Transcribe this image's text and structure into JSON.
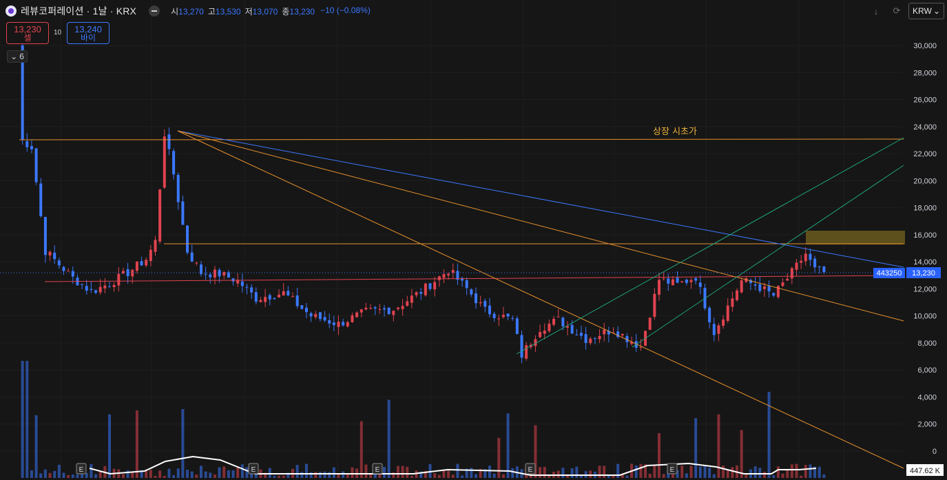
{
  "header": {
    "title": "레뷰코퍼레이션 · 1날 · KRX",
    "ohlc": [
      {
        "key": "시",
        "value": "13,270"
      },
      {
        "key": "고",
        "value": "13,530"
      },
      {
        "key": "저",
        "value": "13,070"
      },
      {
        "key": "종",
        "value": "13,230"
      }
    ],
    "change": "−10 (−0.08%)",
    "icons": {
      "logo": "symbol-logo-icon",
      "visibility": "eye-icon",
      "download": "download-icon",
      "refresh": "refresh-icon"
    }
  },
  "trade": {
    "sell_price": "13,230",
    "sell_label": "셀",
    "spread": "10",
    "buy_price": "13,240",
    "buy_label": "바이"
  },
  "indicators_toggle": {
    "count": "6"
  },
  "currency": "KRW",
  "colors": {
    "up": "#e0434f",
    "down": "#3b78ff",
    "background": "#161616",
    "accent": "#f0b33a"
  },
  "chart_data": {
    "type": "candlestick",
    "title": "",
    "y_ticks": [
      "30,000",
      "28,000",
      "26,000",
      "24,000",
      "22,000",
      "20,000",
      "18,000",
      "16,000",
      "14,000",
      "12,000",
      "10,000",
      "8,000",
      "6,000",
      "4,000",
      "2,000",
      "0"
    ],
    "ylim": [
      0,
      31000
    ],
    "bars_count": 165,
    "price_path_nodes": [
      [
        0,
        30000
      ],
      [
        1,
        23000
      ],
      [
        3,
        22500
      ],
      [
        6,
        14800
      ],
      [
        9,
        13800
      ],
      [
        12,
        12800
      ],
      [
        16,
        11800
      ],
      [
        20,
        12400
      ],
      [
        24,
        13200
      ],
      [
        28,
        14200
      ],
      [
        30,
        15500
      ],
      [
        32,
        23500
      ],
      [
        34,
        20500
      ],
      [
        37,
        14800
      ],
      [
        40,
        13200
      ],
      [
        44,
        13100
      ],
      [
        48,
        12600
      ],
      [
        52,
        11300
      ],
      [
        58,
        11700
      ],
      [
        64,
        10000
      ],
      [
        70,
        9400
      ],
      [
        76,
        10300
      ],
      [
        82,
        10500
      ],
      [
        88,
        11800
      ],
      [
        94,
        13400
      ],
      [
        98,
        12000
      ],
      [
        102,
        10400
      ],
      [
        108,
        9700
      ],
      [
        110,
        7100
      ],
      [
        114,
        9100
      ],
      [
        118,
        9700
      ],
      [
        124,
        8300
      ],
      [
        130,
        9000
      ],
      [
        136,
        7700
      ],
      [
        140,
        12700
      ],
      [
        144,
        12300
      ],
      [
        148,
        12900
      ],
      [
        152,
        8800
      ],
      [
        158,
        12600
      ],
      [
        161,
        12300
      ],
      [
        165,
        11500
      ],
      [
        169,
        13200
      ],
      [
        172,
        14600
      ],
      [
        174,
        13400
      ],
      [
        176,
        13230
      ]
    ],
    "annotation_text": "상장 시초가",
    "last_price_tag": "13,230",
    "last_price_label": "443250",
    "volume_tag": "447.62 K",
    "earnings_markers": [
      "E",
      "E",
      "E",
      "E",
      "E"
    ],
    "grid": true
  }
}
